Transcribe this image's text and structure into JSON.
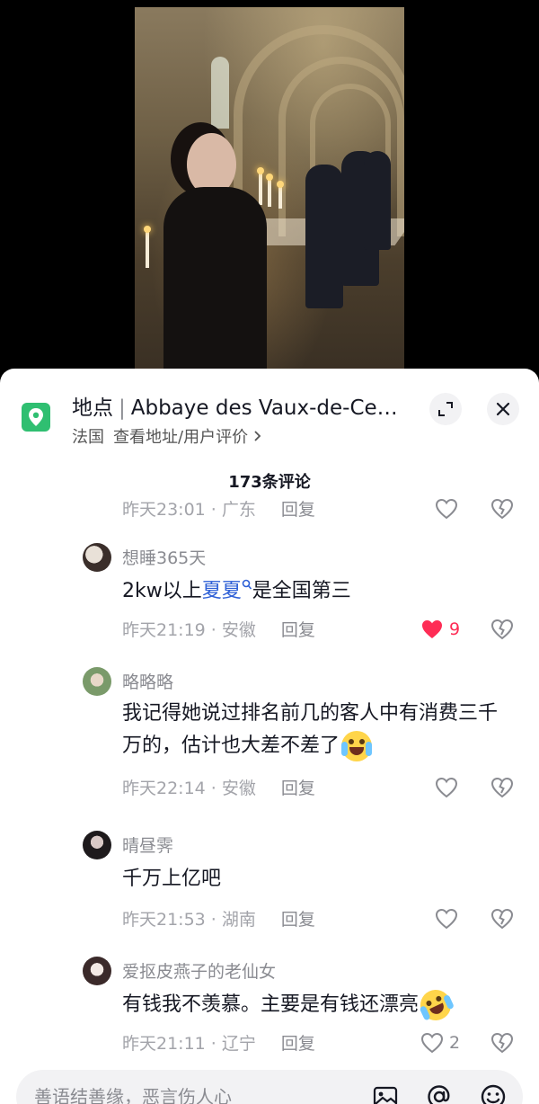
{
  "location": {
    "label": "地点",
    "name": "Abbaye des Vaux-de-Ce…",
    "country": "法国",
    "links": "查看地址/用户评价",
    "accent": "#2fbf71"
  },
  "comments_header": {
    "count_text": "173条评论"
  },
  "partial_row": {
    "time": "昨天23:01",
    "region": "广东",
    "reply": "回复"
  },
  "comments": [
    {
      "username": "想睡365天",
      "text_before": "2kw以上",
      "mention": "夏夏",
      "text_after": "是全国第三",
      "time": "昨天21:19",
      "region": "安徽",
      "reply": "回复",
      "likes": "9",
      "liked": true
    },
    {
      "username": "略略略",
      "text": "我记得她说过排名前几的客人中有消费三千万的，估计也大差不差了",
      "emoji": "laughing-tears-emoji",
      "time": "昨天22:14",
      "region": "安徽",
      "reply": "回复",
      "likes": ""
    },
    {
      "username": "晴昼霁",
      "text": "千万上亿吧",
      "time": "昨天21:53",
      "region": "湖南",
      "reply": "回复",
      "likes": ""
    },
    {
      "username": "爱抠皮燕子的老仙女",
      "text": "有钱我不羡慕。主要是有钱还漂亮",
      "emoji": "rolling-laugh-emoji",
      "time": "昨天21:11",
      "region": "辽宁",
      "reply": "回复",
      "likes": "2"
    }
  ],
  "input": {
    "placeholder": "善语结善缘，恶言伤人心",
    "icons": [
      "image-icon",
      "at-icon",
      "emoji-icon"
    ]
  },
  "colors": {
    "like_active": "#fe2c55",
    "mention": "#2d5fd6",
    "meta": "#a3a4aa"
  }
}
